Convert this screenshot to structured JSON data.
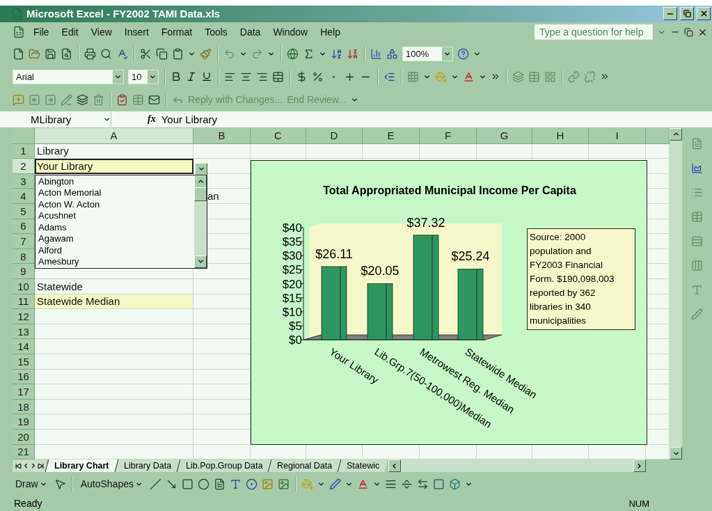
{
  "window": {
    "title": "Microsoft Excel - FY2002 TAMI Data.xls"
  },
  "menu": [
    "File",
    "Edit",
    "View",
    "Insert",
    "Format",
    "Tools",
    "Data",
    "Window",
    "Help"
  ],
  "help_box": {
    "placeholder": "Type a question for help"
  },
  "zoom": {
    "value": "100%"
  },
  "font": {
    "name": "Arial",
    "size": "10"
  },
  "review_toolbar": {
    "reply": "Reply with Changes...",
    "end_review": "End Review..."
  },
  "formula_bar": {
    "name_box": "MLibrary",
    "fx": "fx",
    "value": "Your Library"
  },
  "columns": [
    {
      "letter": "A",
      "selected": true
    },
    {
      "letter": "B",
      "selected": false
    },
    {
      "letter": "C",
      "selected": false
    },
    {
      "letter": "D",
      "selected": false
    },
    {
      "letter": "E",
      "selected": false
    },
    {
      "letter": "F",
      "selected": false
    },
    {
      "letter": "G",
      "selected": false
    },
    {
      "letter": "H",
      "selected": false
    },
    {
      "letter": "I",
      "selected": false
    }
  ],
  "rows": [
    {
      "number": "1",
      "selected": false,
      "cells": {
        "A": {
          "text": "Library",
          "highlighted": false
        }
      }
    },
    {
      "number": "2",
      "selected": true,
      "cells": {
        "A": {
          "text": "Your Library",
          "highlighted": true
        }
      }
    },
    {
      "number": "3",
      "selected": false,
      "cells": {}
    },
    {
      "number": "4",
      "selected": false,
      "cells": {
        "B": {
          "text": "an",
          "highlighted": false,
          "kind": "overflow"
        }
      }
    },
    {
      "number": "5",
      "selected": false,
      "cells": {}
    },
    {
      "number": "6",
      "selected": false,
      "cells": {}
    },
    {
      "number": "7",
      "selected": false,
      "cells": {}
    },
    {
      "number": "8",
      "selected": false,
      "cells": {}
    },
    {
      "number": "9",
      "selected": false,
      "cells": {}
    },
    {
      "number": "10",
      "selected": false,
      "cells": {
        "A": {
          "text": "Statewide",
          "highlighted": false
        }
      }
    },
    {
      "number": "11",
      "selected": false,
      "cells": {
        "A": {
          "text": "Statewide Median",
          "highlighted": true
        }
      }
    },
    {
      "number": "12",
      "selected": false,
      "cells": {}
    },
    {
      "number": "13",
      "selected": false,
      "cells": {}
    },
    {
      "number": "14",
      "selected": false,
      "cells": {}
    },
    {
      "number": "15",
      "selected": false,
      "cells": {}
    },
    {
      "number": "16",
      "selected": false,
      "cells": {}
    },
    {
      "number": "17",
      "selected": false,
      "cells": {}
    },
    {
      "number": "18",
      "selected": false,
      "cells": {}
    },
    {
      "number": "19",
      "selected": false,
      "cells": {}
    },
    {
      "number": "20",
      "selected": false,
      "cells": {}
    },
    {
      "number": "21",
      "selected": false,
      "cells": {}
    }
  ],
  "dropdown": {
    "items": [
      "Abington",
      "Acton Memorial",
      "Acton W. Acton",
      "Acushnet",
      "Adams",
      "Agawam",
      "Alford",
      "Amesbury"
    ]
  },
  "chart": {
    "chart_data": {
      "type": "bar",
      "title": "Total Appropriated Municipal Income Per Capita",
      "categories": [
        "Your Library",
        "Lib.Grp.7(50-100,000)Median",
        "Metrowest Reg. Median",
        "Statewide Median"
      ],
      "values": [
        26.11,
        20.05,
        37.32,
        25.24
      ],
      "value_labels": [
        "$26.11",
        "$20.05",
        "$37.32",
        "$25.24"
      ],
      "ylim": [
        0,
        40
      ],
      "yticks": [
        {
          "value": 0,
          "label": "$0"
        },
        {
          "value": 5,
          "label": "$5"
        },
        {
          "value": 10,
          "label": "$10"
        },
        {
          "value": 15,
          "label": "$15"
        },
        {
          "value": 20,
          "label": "$20"
        },
        {
          "value": 25,
          "label": "$25"
        },
        {
          "value": 30,
          "label": "$30"
        },
        {
          "value": 35,
          "label": "$35"
        },
        {
          "value": 40,
          "label": "$40"
        }
      ]
    },
    "note": [
      "Source: 2000",
      "population and",
      "FY2003 Financial",
      "Form. $190,098,003",
      "reported by 362",
      "libraries in 340",
      "municipalities"
    ]
  },
  "sheet_tabs": [
    {
      "label": "Library Chart",
      "selected": true
    },
    {
      "label": "Library Data",
      "selected": false
    },
    {
      "label": "Lib.Pop.Group Data",
      "selected": false
    },
    {
      "label": "Regional Data",
      "selected": false
    },
    {
      "label": "Statewic",
      "selected": false
    }
  ],
  "drawing_toolbar": {
    "draw": "Draw",
    "autoshapes": "AutoShapes"
  },
  "status_bar": {
    "status": "Ready",
    "num": "NUM"
  }
}
